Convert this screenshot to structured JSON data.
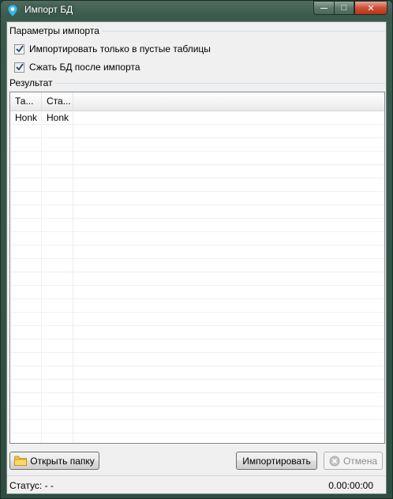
{
  "window": {
    "title": "Импорт БД",
    "minimize_glyph": "—",
    "maximize_glyph": "□",
    "close_glyph": "✕"
  },
  "import_params": {
    "legend": "Параметры импорта",
    "only_empty_tables": {
      "label": "Импортировать только в пустые таблицы",
      "checked": true
    },
    "compress_after": {
      "label": "Сжать БД после импорта",
      "checked": true
    }
  },
  "result": {
    "legend": "Результат",
    "columns": [
      "Та...",
      "Ста..."
    ],
    "rows": [
      [
        "Honk",
        "Honk"
      ]
    ]
  },
  "buttons": {
    "open_folder": "Открыть папку",
    "import": "Импортировать",
    "cancel": "Отмена"
  },
  "status": {
    "label": "Статус: - -",
    "elapsed": "0.00:00:00"
  },
  "colors": {
    "title_bar": "#3b5a4d",
    "client_bg": "#f0f0f0",
    "close_button": "#cf4f37"
  },
  "icons": {
    "app": "map-pin-icon",
    "open_folder": "folder-icon",
    "cancel": "cancel-circle-icon"
  }
}
